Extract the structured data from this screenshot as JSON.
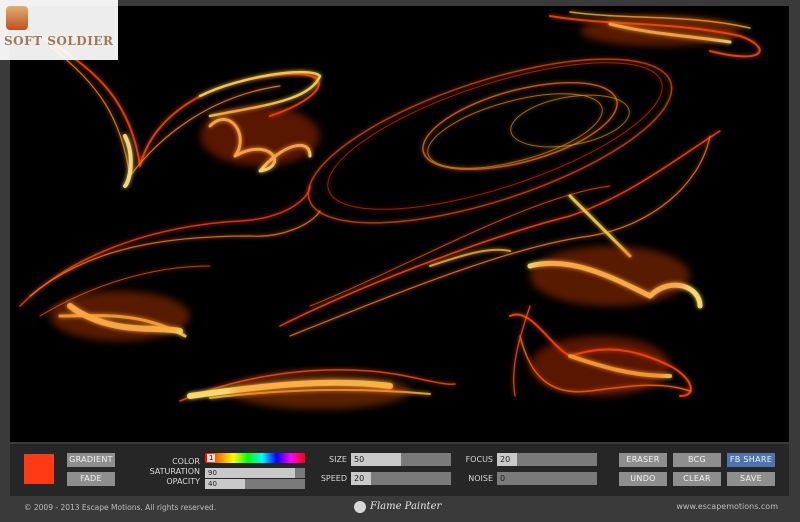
{
  "watermark": {
    "text": "SOFT SOLDIER"
  },
  "controls": {
    "gradient_label": "GRADIENT",
    "fade_label": "FADE",
    "color_label": "COLOR",
    "color_value": "1",
    "saturation_label": "SATURATION",
    "saturation_value": "90",
    "saturation_level": 0.9,
    "opacity_label": "OPACITY",
    "opacity_value": "40",
    "opacity_level": 0.4,
    "size_label": "SIZE",
    "size_value": "50",
    "size_level": 0.5,
    "speed_label": "SPEED",
    "speed_value": "20",
    "speed_level": 0.2,
    "focus_label": "FOCUS",
    "focus_value": "20",
    "focus_level": 0.2,
    "noise_label": "NOISE",
    "noise_value": "0",
    "noise_level": 0,
    "eraser_label": "ERASER",
    "bcg_label": "BCG",
    "fbshare_label": "FB SHARE",
    "undo_label": "UNDO",
    "clear_label": "CLEAR",
    "save_label": "SAVE",
    "swatch_color": "#ff3a14"
  },
  "footer": {
    "copyright": "© 2009 - 2013 Escape Motions. All rights reserved.",
    "brand": "Flame Painter",
    "website": "www.escapemotions.com"
  }
}
